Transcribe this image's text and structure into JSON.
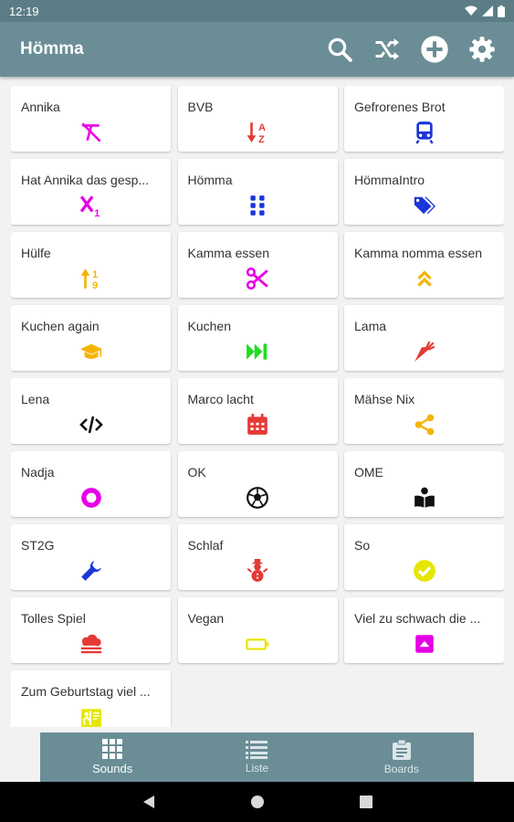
{
  "status_bar": {
    "time": "12:19"
  },
  "app_bar": {
    "title": "Hömma",
    "actions": [
      "search-icon",
      "shuffle-icon",
      "add-circle-icon",
      "settings-icon"
    ]
  },
  "sounds": [
    {
      "label": "Annika",
      "icon": "text-format-clear-icon",
      "color": "#e600e6"
    },
    {
      "label": "BVB",
      "icon": "sort-az-icon",
      "color": "#e53935"
    },
    {
      "label": "Gefrorenes Brot",
      "icon": "train-icon",
      "color": "#1a35d9"
    },
    {
      "label": "Hat Annika das gesp...",
      "icon": "subscript-icon",
      "color": "#e600e6"
    },
    {
      "label": "Hömma",
      "icon": "dots-grid-icon",
      "color": "#1a35d9"
    },
    {
      "label": "HömmaIntro",
      "icon": "tags-icon",
      "color": "#1a35d9"
    },
    {
      "label": "Hülfe",
      "icon": "sort-numeric-icon",
      "color": "#f5b400"
    },
    {
      "label": "Kamma essen",
      "icon": "scissors-icon",
      "color": "#e600e6"
    },
    {
      "label": "Kamma nomma essen",
      "icon": "double-chevron-up-icon",
      "color": "#f5b400"
    },
    {
      "label": "Kuchen again",
      "icon": "graduation-cap-icon",
      "color": "#f5b400"
    },
    {
      "label": "Kuchen",
      "icon": "fast-forward-icon",
      "color": "#22dd22"
    },
    {
      "label": "Lama",
      "icon": "carrot-icon",
      "color": "#e53935"
    },
    {
      "label": "Lena",
      "icon": "code-icon",
      "color": "#111111"
    },
    {
      "label": "Marco lacht",
      "icon": "calendar-icon",
      "color": "#e53935"
    },
    {
      "label": "Mähse Nix",
      "icon": "share-icon",
      "color": "#f5b400"
    },
    {
      "label": "Nadja",
      "icon": "record-circle-icon",
      "color": "#e600e6"
    },
    {
      "label": "OK",
      "icon": "soccer-ball-icon",
      "color": "#111111"
    },
    {
      "label": "OME",
      "icon": "reading-icon",
      "color": "#111111"
    },
    {
      "label": "ST2G",
      "icon": "wrench-icon",
      "color": "#1a35d9"
    },
    {
      "label": "Schlaf",
      "icon": "snowman-icon",
      "color": "#e53935"
    },
    {
      "label": "So",
      "icon": "check-circle-icon",
      "color": "#e6e600"
    },
    {
      "label": "Tolles Spiel",
      "icon": "cloud-icon",
      "color": "#e53935"
    },
    {
      "label": "Vegan",
      "icon": "battery-empty-icon",
      "color": "#e6e600"
    },
    {
      "label": "Viel zu schwach die ...",
      "icon": "up-square-icon",
      "color": "#e600e6"
    },
    {
      "label": "Zum Geburtstag viel ...",
      "icon": "book-reader-icon",
      "color": "#e6e600"
    }
  ],
  "bottom_nav": [
    {
      "label": "Sounds",
      "icon": "grid-icon",
      "active": true
    },
    {
      "label": "Liste",
      "icon": "list-icon",
      "active": false
    },
    {
      "label": "Boards",
      "icon": "clipboard-icon",
      "active": false
    }
  ]
}
